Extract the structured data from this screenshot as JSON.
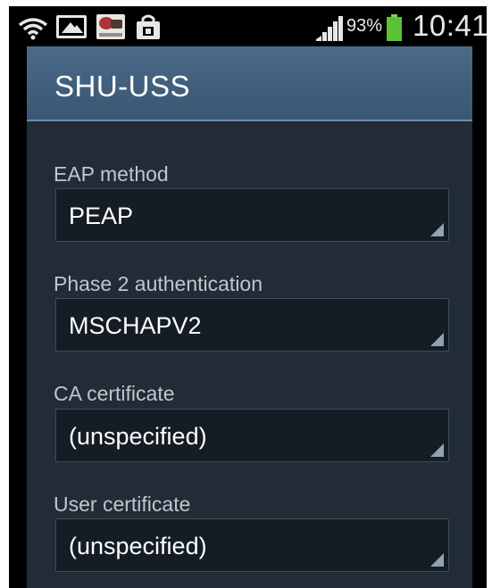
{
  "status_bar": {
    "icons": [
      "wifi-icon",
      "gallery-icon",
      "app-icon",
      "shopping-bag-icon",
      "signal-icon",
      "battery-icon"
    ],
    "battery_percent": "93%",
    "time": "10:41",
    "battery_color": "#5bc236"
  },
  "dialog": {
    "title": "SHU-USS",
    "header_color": "#3f5f7e",
    "fields": [
      {
        "label": "EAP method",
        "value": "PEAP"
      },
      {
        "label": "Phase 2 authentication",
        "value": "MSCHAPV2"
      },
      {
        "label": "CA certificate",
        "value": "(unspecified)"
      },
      {
        "label": "User certificate",
        "value": "(unspecified)"
      }
    ]
  }
}
